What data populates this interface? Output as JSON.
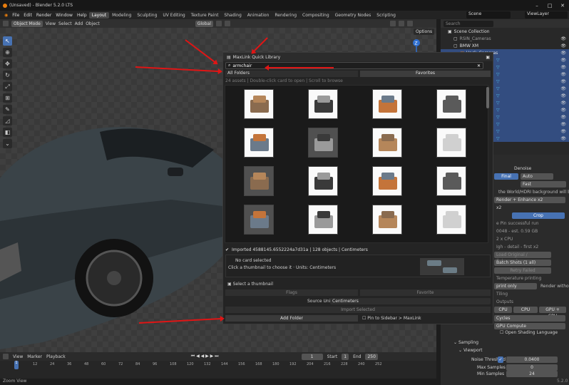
{
  "window": {
    "title": "(Unsaved) - Blender 5.2.0 LTS"
  },
  "menubar": {
    "menus": [
      "File",
      "Edit",
      "Render",
      "Window",
      "Help"
    ],
    "tabs": [
      "Layout",
      "Modeling",
      "Sculpting",
      "UV Editing",
      "Texture Paint",
      "Shading",
      "Animation",
      "Rendering",
      "Compositing",
      "Geometry Nodes",
      "Scripting"
    ],
    "scene": "Scene",
    "view_layer": "ViewLayer"
  },
  "viewport_header": {
    "mode": "Object Mode",
    "menus": [
      "View",
      "Select",
      "Add",
      "Object"
    ],
    "transform": "Global",
    "options": "Options"
  },
  "outliner": {
    "search_placeholder": "Search",
    "items": [
      "Scene Collection",
      "RSIN_Cameras",
      "BMW XM",
      "Hack_Cameras"
    ]
  },
  "dialog": {
    "title": "MaxLink Quick Library",
    "search_value": "armchair",
    "folder": "All Folders",
    "favorites": "Favorites",
    "hint": "24 assets | Double-click card to open | Scroll to browse",
    "status": "Imported 4588145.6552224a7d31a | 128 objects | Centimeters",
    "card_title": "No card selected",
    "card_desc": "Click a thumbnail to choose it · Units: Centimeters",
    "select_thumb": "Select a thumbnail",
    "flags": "Flags",
    "favorite": "Favorite",
    "source_units_label": "Source Units",
    "source_units": "Centimeters",
    "import_selected": "Import Selected",
    "add_folder": "Add Folder",
    "pin": "Pin to Sidebar > MaxLink"
  },
  "props": {
    "denoise": "Denoise",
    "final": "Final",
    "auto": "Auto",
    "fast": "Fast",
    "warn": "the World/HDRI background will be n",
    "enhance": "Render + Enhance x2",
    "x2": "x2",
    "crop": "Crop",
    "l1": "e Pin successful run",
    "l2": "0048 - est. 0.59 GB",
    "l3": "2 x CPU",
    "l4": "Igh - detail - first x2",
    "l5": "Load Original / Enhanced",
    "l6": "Batch Shots (1 all)",
    "l7": "Retry Failed",
    "l8": "Temperature printing",
    "l9": "print only",
    "l10": "Render without AI",
    "l11": "Tiling",
    "l12": "Outputs",
    "cpu1": "CPU",
    "cpu2": "CPU",
    "gpucpu": "GPU + CPU",
    "cycles": "Cycles",
    "gpu_compute": "GPU Compute",
    "osl": "Open Shading Language",
    "sampling": "Sampling",
    "viewport": "Viewport",
    "noise_threshold_label": "Noise Threshold",
    "noise_threshold": "0.0400",
    "max_samples_label": "Max Samples",
    "max_samples": "0",
    "min_samples_label": "Min Samples",
    "min_samples": "24",
    "version": "5.2.0"
  },
  "timeline": {
    "menus": [
      "View",
      "Marker",
      "Playback"
    ],
    "current": "1",
    "start_label": "Start",
    "start": "1",
    "end_label": "End",
    "end": "250",
    "ticks": [
      "1",
      "12",
      "24",
      "36",
      "48",
      "60",
      "72",
      "84",
      "96",
      "108",
      "120",
      "132",
      "144",
      "156",
      "168",
      "180",
      "192",
      "204",
      "216",
      "228",
      "240",
      "252"
    ]
  },
  "status_bar": {
    "left": "Zoom View"
  },
  "colors": {
    "accent": "#4772b3",
    "arrow": "#e01515",
    "orange": "#e87d0d"
  }
}
